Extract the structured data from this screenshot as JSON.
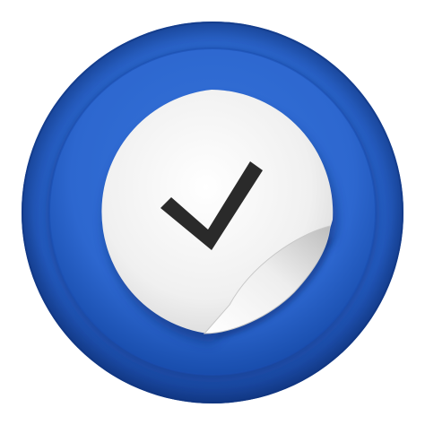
{
  "icon": {
    "name": "checkmark-sticker-icon",
    "colors": {
      "outer_ring_light": "#3e7fe4",
      "outer_ring_dark": "#123a8c",
      "inner_disc_light": "#3573d9",
      "inner_disc_dark": "#164aa8",
      "sticker_light": "#ffffff",
      "sticker_shade": "#d9d9d9",
      "check": "#2a2a2a",
      "curl_shadow": "#0c2c6e"
    }
  }
}
